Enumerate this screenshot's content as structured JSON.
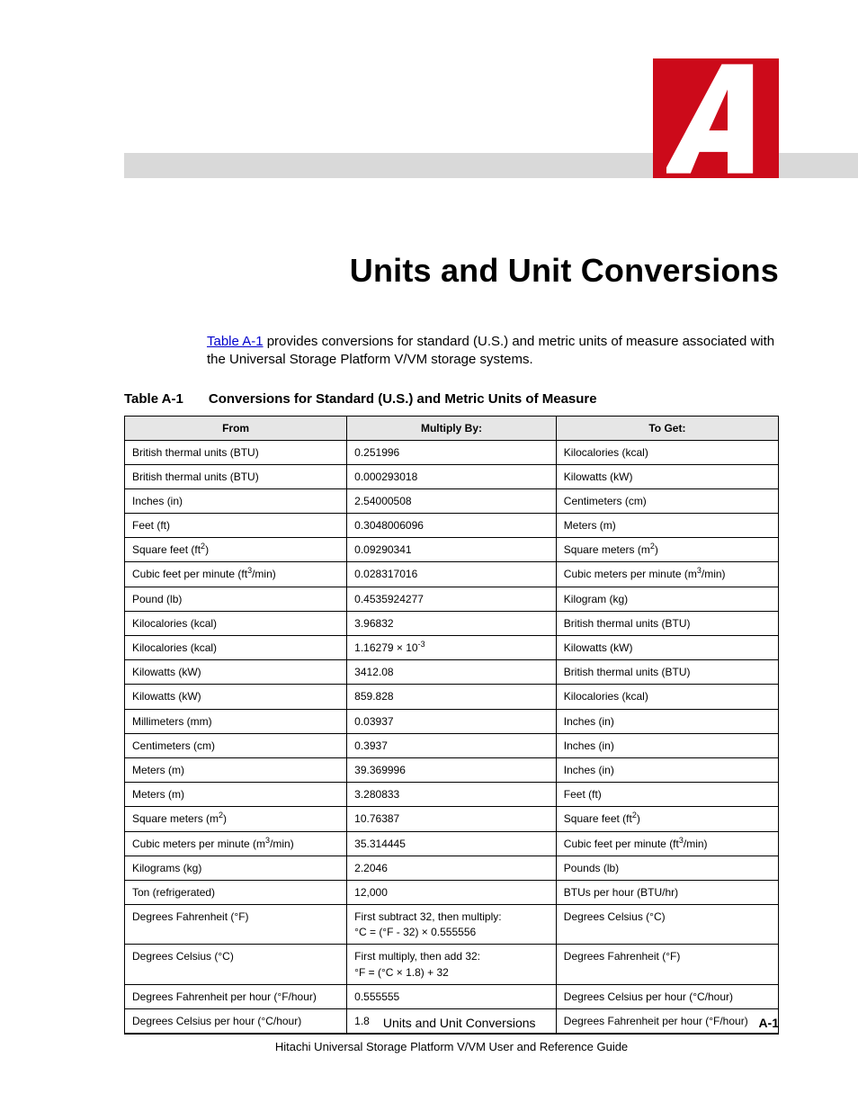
{
  "logo_letter": "A",
  "title": "Units and Unit Conversions",
  "intro_link": "Table A-1",
  "intro_rest": " provides conversions for standard (U.S.) and metric units of measure associated with the Universal Storage Platform V/VM storage systems.",
  "table_label": "Table A-1",
  "table_title": "Conversions for Standard (U.S.) and Metric Units of Measure",
  "headers": {
    "from": "From",
    "multiply": "Multiply By:",
    "to": "To Get:"
  },
  "rows": [
    {
      "from": "British thermal units (BTU)",
      "multiply": "0.251996",
      "to": "Kilocalories (kcal)"
    },
    {
      "from": "British thermal units (BTU)",
      "multiply": "0.000293018",
      "to": "Kilowatts (kW)"
    },
    {
      "from": "Inches (in)",
      "multiply": "2.54000508",
      "to": "Centimeters (cm)"
    },
    {
      "from": "Feet (ft)",
      "multiply": "0.3048006096",
      "to": "Meters (m)"
    },
    {
      "from": "Square feet (ft<sup>2</sup>)",
      "multiply": "0.09290341",
      "to": "Square meters (m<sup>2</sup>)"
    },
    {
      "from": "Cubic feet per minute (ft<sup>3</sup>/min)",
      "multiply": "0.028317016",
      "to": "Cubic meters per minute (m<sup>3</sup>/min)"
    },
    {
      "from": "Pound (lb)",
      "multiply": "0.4535924277",
      "to": "Kilogram (kg)"
    },
    {
      "from": "Kilocalories (kcal)",
      "multiply": "3.96832",
      "to": "British thermal units (BTU)"
    },
    {
      "from": "Kilocalories (kcal)",
      "multiply": "1.16279 × 10<sup>-3</sup>",
      "to": "Kilowatts (kW)"
    },
    {
      "from": "Kilowatts (kW)",
      "multiply": "3412.08",
      "to": "British thermal units (BTU)"
    },
    {
      "from": "Kilowatts (kW)",
      "multiply": "859.828",
      "to": "Kilocalories (kcal)"
    },
    {
      "from": "Millimeters (mm)",
      "multiply": "0.03937",
      "to": "Inches (in)"
    },
    {
      "from": "Centimeters (cm)",
      "multiply": "0.3937",
      "to": "Inches (in)"
    },
    {
      "from": "Meters (m)",
      "multiply": "39.369996",
      "to": "Inches (in)"
    },
    {
      "from": "Meters (m)",
      "multiply": "3.280833",
      "to": "Feet (ft)"
    },
    {
      "from": "Square meters (m<sup>2</sup>)",
      "multiply": "10.76387",
      "to": "Square feet (ft<sup>2</sup>)"
    },
    {
      "from": "Cubic meters per minute (m<sup>3</sup>/min)",
      "multiply": "35.314445",
      "to": "Cubic feet per minute (ft<sup>3</sup>/min)"
    },
    {
      "from": "Kilograms (kg)",
      "multiply": "2.2046",
      "to": "Pounds (lb)"
    },
    {
      "from": "Ton (refrigerated)",
      "multiply": "12,000",
      "to": "BTUs per hour (BTU/hr)"
    },
    {
      "from": "Degrees Fahrenheit (°F)",
      "multiply": "First subtract 32, then multiply:<span class=\"formula\">°C = (°F - 32) × 0.555556</span>",
      "to": "Degrees Celsius (°C)"
    },
    {
      "from": "Degrees Celsius (°C)",
      "multiply": "First multiply, then add 32:<span class=\"formula\">°F = (°C  × 1.8) + 32</span>",
      "to": "Degrees Fahrenheit (°F)"
    },
    {
      "from": "Degrees Fahrenheit per hour (°F/hour)",
      "multiply": "0.555555",
      "to": "Degrees Celsius per hour (°C/hour)"
    },
    {
      "from": "Degrees Celsius per hour (°C/hour)",
      "multiply": "1.8",
      "to": "Degrees Fahrenheit per hour (°F/hour)"
    }
  ],
  "footer_title": "Units and Unit Conversions",
  "footer_page": "A-1",
  "footer_guide": "Hitachi Universal Storage Platform V/VM User and Reference Guide"
}
